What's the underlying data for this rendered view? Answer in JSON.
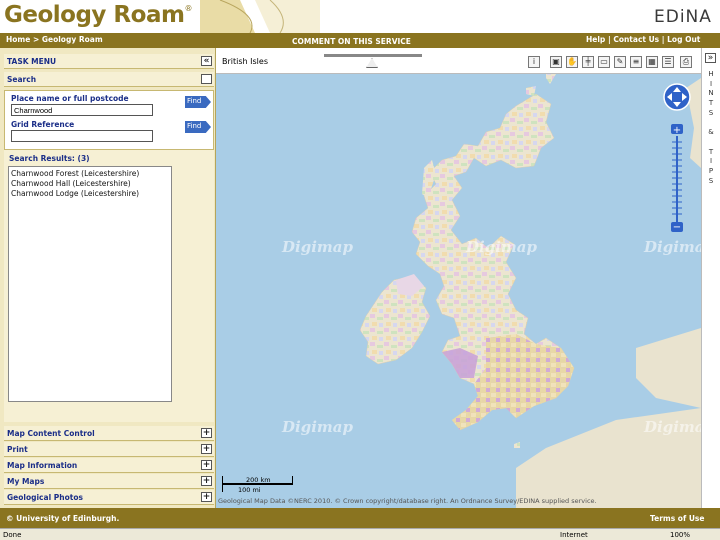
{
  "header": {
    "app_title": "Geology Roam",
    "registered_mark": "®",
    "brand": "EDiNA"
  },
  "nav": {
    "breadcrumb": "Home > Geology Roam",
    "comment_link": "COMMENT ON THIS SERVICE",
    "help": "Help",
    "contact": "Contact Us",
    "logout": "Log Out",
    "separator": "|"
  },
  "left_panel": {
    "task_menu": "TASK MENU",
    "search_title": "Search",
    "place_label": "Place name or full postcode",
    "place_value": "Charnwood",
    "grid_label": "Grid Reference",
    "grid_value": "",
    "find_label": "Find",
    "results_title": "Search Results: (3)",
    "results": [
      "Charnwood Forest (Leicestershire)",
      "Charnwood Hall (Leicestershire)",
      "Charnwood Lodge (Leicestershire)"
    ],
    "sections": [
      "Map Content Control",
      "Print",
      "Map Information",
      "My Maps",
      "Geological Photos"
    ]
  },
  "map": {
    "region": "British Isles",
    "watermark": "Digimap",
    "scale_top": "200 km",
    "scale_bottom": "100 mi",
    "attribution": "Geological Map Data ©NERC 2010. © Crown copyright/database right. An Ordnance Survey/EDINA supplied service.",
    "colors": {
      "sea": "#a9cde6",
      "land": "#e9e3cf",
      "brand": "#8a7420"
    }
  },
  "hints": {
    "letters": [
      "H",
      "I",
      "N",
      "T",
      "S",
      "",
      "&",
      "",
      "T",
      "I",
      "P",
      "S"
    ]
  },
  "footer": {
    "left": "© University of Edinburgh.",
    "right": "Terms of Use"
  },
  "statusbar": {
    "done": "Done",
    "zone": "Internet",
    "zoom": "100%"
  }
}
